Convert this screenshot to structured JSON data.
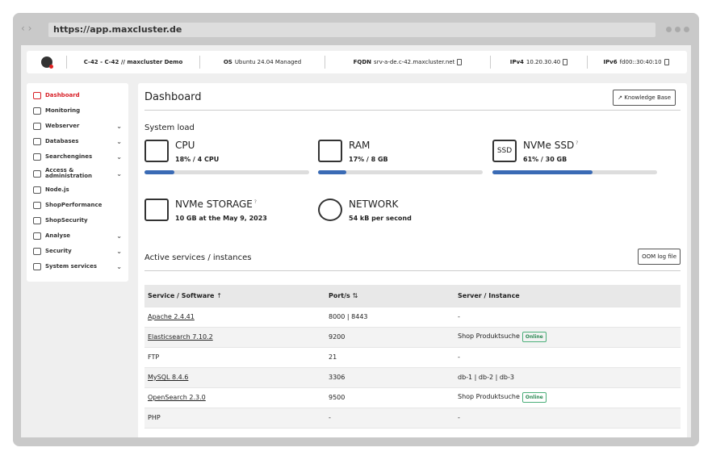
{
  "browser": {
    "url": "https://app.maxcluster.de",
    "back": "‹",
    "forward": "›"
  },
  "infobar": {
    "cluster": "C-42 - C-42 // maxcluster Demo",
    "os_label": "OS",
    "os_value": "Ubuntu 24.04 Managed",
    "fqdn_label": "FQDN",
    "fqdn_value": "srv-a-de.c-42.maxcluster.net",
    "ipv4_label": "IPv4",
    "ipv4_value": "10.20.30.40",
    "ipv6_label": "IPv6",
    "ipv6_value": "fd00::30:40:10"
  },
  "sidebar": {
    "items": [
      {
        "label": "Dashboard",
        "icon": "dashboard-icon",
        "active": true
      },
      {
        "label": "Monitoring",
        "icon": "monitoring-icon"
      },
      {
        "label": "Webserver",
        "icon": "webserver-icon",
        "chevron": "⌄"
      },
      {
        "label": "Databases",
        "icon": "databases-icon",
        "chevron": "⌄"
      },
      {
        "label": "Searchengines",
        "icon": "search-icon",
        "chevron": "⌄"
      },
      {
        "label": "Access & administration",
        "icon": "key-icon",
        "chevron": "⌄"
      },
      {
        "label": "Node.js",
        "icon": "nodejs-icon"
      },
      {
        "label": "ShopPerformance",
        "icon": "gauge-icon"
      },
      {
        "label": "ShopSecurity",
        "icon": "lock-icon"
      },
      {
        "label": "Analyse",
        "icon": "analyse-icon",
        "chevron": "⌄"
      },
      {
        "label": "Security",
        "icon": "shield-icon",
        "chevron": "⌄"
      },
      {
        "label": "System services",
        "icon": "gear-icon",
        "chevron": "⌄"
      }
    ]
  },
  "main": {
    "title": "Dashboard",
    "kb_button": "Knowledge Base",
    "system_load": "System load",
    "cards": [
      {
        "title": "CPU",
        "sub": "18% / 4 CPU",
        "percent": 18
      },
      {
        "title": "RAM",
        "sub": "17% / 8 GB",
        "percent": 17
      },
      {
        "title": "NVMe SSD",
        "sub": "61% / 30 GB",
        "percent": 61,
        "ssd_label": "SSD"
      },
      {
        "title": "NVMe STORAGE",
        "sub": "10 GB at the May 9, 2023"
      },
      {
        "title": "NETWORK",
        "sub": "54 kB per second"
      }
    ],
    "services_title": "Active services / instances",
    "oom_button": "OOM log file",
    "table": {
      "headers": [
        "Service / Software",
        "Port/s",
        "Server / Instance"
      ],
      "sort_up": "↑",
      "sort_both": "⇅",
      "rows": [
        [
          "Apache 2.4.41",
          "8000 | 8443",
          "-",
          ""
        ],
        [
          "Elasticsearch 7.10.2",
          "9200",
          "Shop Produktsuche",
          "Online"
        ],
        [
          "FTP",
          "21",
          "-",
          ""
        ],
        [
          "MySQL 8.4.6",
          "3306",
          "db-1 | db-2 | db-3",
          ""
        ],
        [
          "OpenSearch 2.3.0",
          "9500",
          "Shop Produktsuche",
          "Online"
        ],
        [
          "PHP",
          "-",
          "-",
          ""
        ]
      ]
    }
  }
}
